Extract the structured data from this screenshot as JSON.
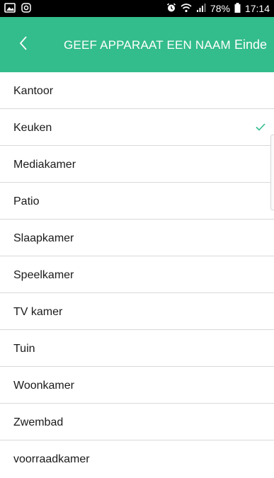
{
  "status_bar": {
    "battery": "78%",
    "time": "17:14",
    "left_icons": [
      "gallery-icon",
      "instagram-icon"
    ],
    "right_icons": [
      "alarm-icon",
      "wifi-icon",
      "signal-icon",
      "battery-icon"
    ]
  },
  "header": {
    "back_icon": "chevron-left-icon",
    "title": "GEEF APPARAAT EEN NAAM",
    "done_label": "Einde",
    "background_color": "#33bc8c"
  },
  "list": {
    "items": [
      {
        "label": "Kantoor",
        "selected": false
      },
      {
        "label": "Keuken",
        "selected": true
      },
      {
        "label": "Mediakamer",
        "selected": false
      },
      {
        "label": "Patio",
        "selected": false
      },
      {
        "label": "Slaapkamer",
        "selected": false
      },
      {
        "label": "Speelkamer",
        "selected": false
      },
      {
        "label": "TV kamer",
        "selected": false
      },
      {
        "label": "Tuin",
        "selected": false
      },
      {
        "label": "Woonkamer",
        "selected": false
      },
      {
        "label": "Zwembad",
        "selected": false
      },
      {
        "label": "voorraadkamer",
        "selected": false
      }
    ],
    "check_icon": "checkmark-icon",
    "check_color": "#33bc8c"
  }
}
